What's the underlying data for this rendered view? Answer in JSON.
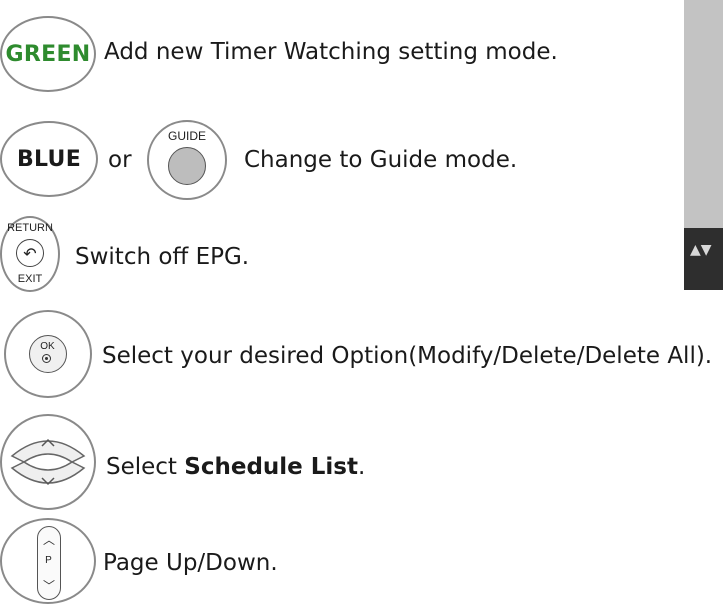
{
  "rows": [
    {
      "key_label": "GREEN",
      "description": "Add new Timer Watching setting mode."
    },
    {
      "key_label": "BLUE",
      "connector": "or",
      "guide_label": "GUIDE",
      "description": "Change to Guide mode."
    },
    {
      "return_label": "RETURN",
      "exit_label": "EXIT",
      "description": "Switch off EPG."
    },
    {
      "ok_label": "OK",
      "description": "Select your desired Option(Modify/Delete/Delete All)."
    },
    {
      "description_prefix": "Select ",
      "description_bold": "Schedule List",
      "description_suffix": "."
    },
    {
      "p_label": "P",
      "description": "Page Up/Down."
    }
  ],
  "side_panel": {
    "arrows": "▲▼"
  },
  "colors": {
    "green_key": "#2e8b2e",
    "blue_key": "#1a1a1a",
    "border": "#8a8a8a",
    "panel": "#c3c3c3"
  }
}
